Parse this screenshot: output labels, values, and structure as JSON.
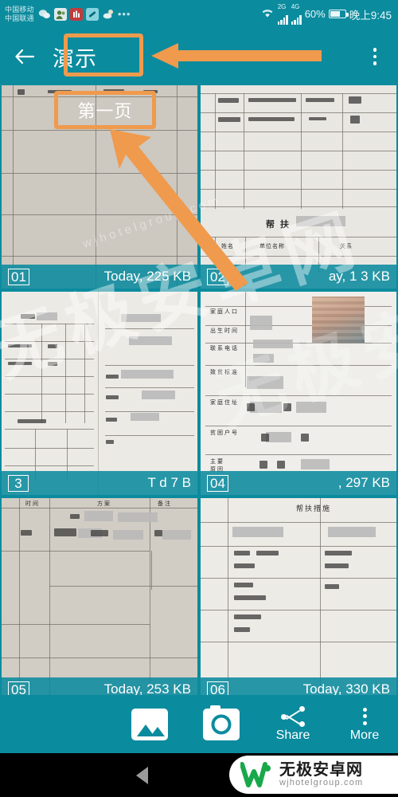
{
  "statusbar": {
    "carrier_line1": "中国移动",
    "carrier_line2": "中国联通",
    "notif_icons": [
      "wechat-icon",
      "contacts-icon",
      "app-red-icon",
      "link-icon",
      "weather-icon",
      "more-dots-icon"
    ],
    "wifi_icon": "wifi-icon",
    "signal1_label": "2G",
    "signal2_label": "4G",
    "battery_percent": "60%",
    "time": "晚上9:45"
  },
  "appbar": {
    "back_icon": "back-arrow-icon",
    "title": "演示",
    "overflow_icon": "overflow-menu-icon"
  },
  "annotations": {
    "title_box": "演示",
    "title_arrow": "left-pointing-arrow",
    "page_label": "第一页",
    "page_arrow": "diagonal-arrow"
  },
  "grid": {
    "items": [
      {
        "num": "01",
        "meta": "Today, 225 KB",
        "thumb": "handwritten-grid-form"
      },
      {
        "num": "02",
        "meta": "ay, 1 3 KB",
        "thumb": "handwritten-table-bangfu"
      },
      {
        "num": "3",
        "meta": "T d   7  B",
        "thumb": "open-notebook-tables"
      },
      {
        "num": "04",
        "meta": ", 297 KB",
        "thumb": "form-with-id-photo"
      },
      {
        "num": "05",
        "meta": "Today, 253 KB",
        "thumb": "handwritten-wide-table"
      },
      {
        "num": "06",
        "meta": "Today, 330 KB",
        "thumb": "bangfu-record-table"
      }
    ],
    "thumb2_header": "帮 扶",
    "thumb2_cols": [
      "姓名",
      "单位名称",
      "关系"
    ],
    "thumb6_header": "帮扶措施"
  },
  "watermark": {
    "big_text": "无极安卓网",
    "sub_text": "wjhotelgroup.com"
  },
  "toolbar": {
    "gallery_icon": "gallery-icon",
    "camera_icon": "camera-icon",
    "share_icon": "share-icon",
    "share_label": "Share",
    "more_icon": "more-dots-icon",
    "more_label": "More"
  },
  "navbar": {
    "back_icon": "nav-back-icon",
    "home_icon": "nav-home-icon"
  },
  "site_badge": {
    "logo": "w-logo-icon",
    "name": "无极安卓网",
    "url": "wjhotelgroup.com"
  },
  "colors": {
    "teal": "#0b8b9e",
    "orange": "#ef9a4d",
    "white": "#ffffff",
    "nav_black": "#000000"
  }
}
